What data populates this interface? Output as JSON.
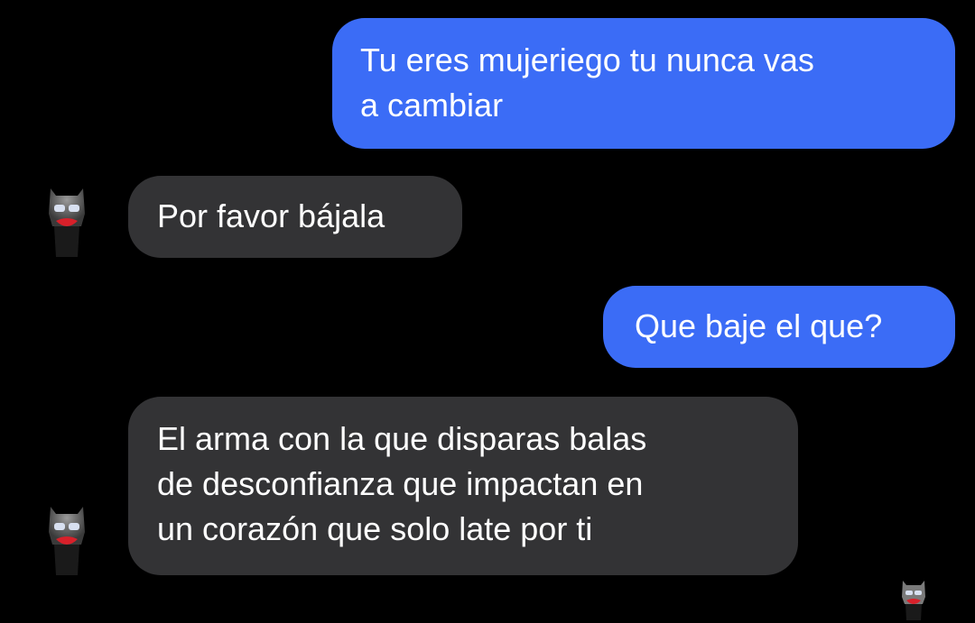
{
  "colors": {
    "background": "#000000",
    "sent_bubble": "#3b6cf6",
    "received_bubble": "#333335",
    "text": "#ffffff"
  },
  "messages": [
    {
      "direction": "sent",
      "lines": [
        "Tu eres mujeriego tu nunca vas",
        "a cambiar"
      ]
    },
    {
      "direction": "received",
      "lines": [
        "Por favor bájala"
      ],
      "avatar_icon": "batman-mask-avatar-icon"
    },
    {
      "direction": "sent",
      "lines": [
        "Que baje el que?"
      ]
    },
    {
      "direction": "received",
      "lines": [
        "El arma con la que disparas balas",
        "de desconfianza que impactan en",
        "un corazón que solo late por ti"
      ],
      "avatar_icon": "batman-mask-avatar-icon"
    }
  ],
  "read_receipt": {
    "icon": "batman-mask-avatar-icon"
  }
}
